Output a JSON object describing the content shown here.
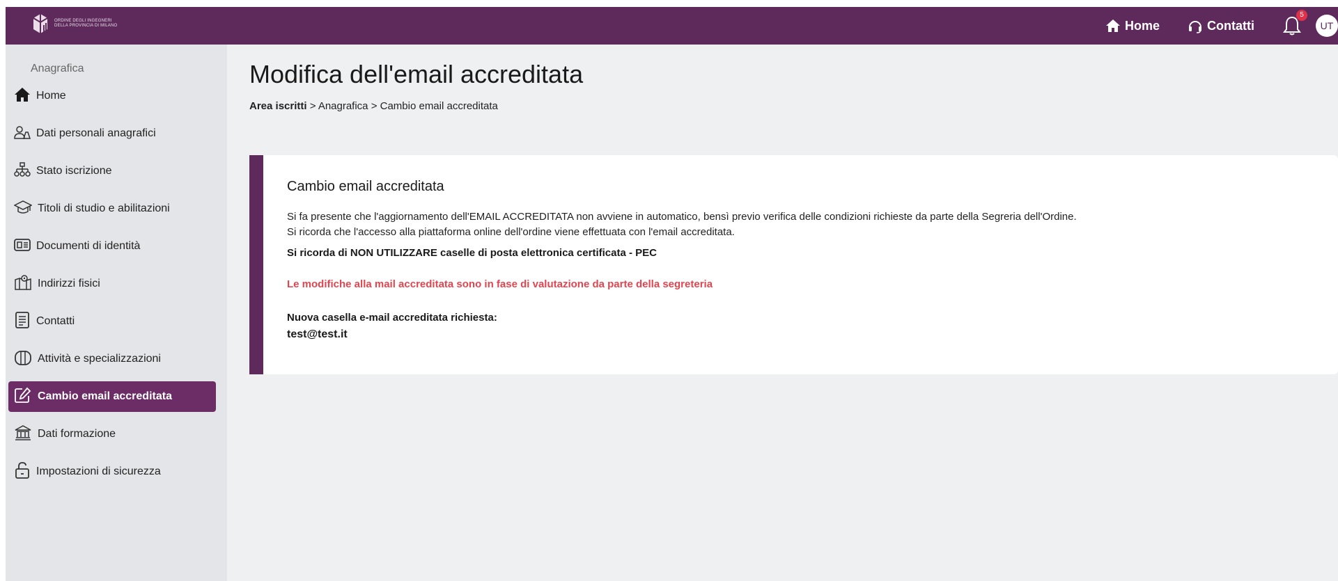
{
  "header": {
    "logo_text_line1": "ORDINE DEGLI INGEGNERI",
    "logo_text_line2": "DELLA PROVINCIA DI MILANO",
    "nav_home": "Home",
    "nav_contatti": "Contatti",
    "notifications_count": "5",
    "avatar_initials": "UT",
    "brand_color": "#5e2a5c"
  },
  "sidebar": {
    "title": "Anagrafica",
    "items": [
      {
        "label": "Home",
        "icon": "home-icon"
      },
      {
        "label": "Dati personali anagrafici",
        "icon": "users-icon"
      },
      {
        "label": "Stato iscrizione",
        "icon": "hierarchy-icon"
      },
      {
        "label": "Titoli di studio e abilitazioni",
        "icon": "graduation-cap-icon"
      },
      {
        "label": "Documenti di identità",
        "icon": "id-card-icon"
      },
      {
        "label": "Indirizzi fisici",
        "icon": "map-pin-icon"
      },
      {
        "label": "Contatti",
        "icon": "document-list-icon"
      },
      {
        "label": "Attività e specializzazioni",
        "icon": "briefcase-icon"
      },
      {
        "label": "Cambio email accreditata",
        "icon": "edit-icon",
        "active": true
      },
      {
        "label": "Dati formazione",
        "icon": "bank-icon"
      },
      {
        "label": "Impostazioni di sicurezza",
        "icon": "unlock-icon"
      }
    ]
  },
  "main": {
    "title": "Modifica dell'email accreditata",
    "breadcrumb": {
      "root": "Area iscritti",
      "rest": " > Anagrafica > Cambio email accreditata"
    },
    "card": {
      "title": "Cambio email accreditata",
      "p1": "Si fa presente che l'aggiornamento dell'EMAIL ACCREDITATA non avviene in automatico, bensì previo verifica delle condizioni richieste da parte della Segreria dell'Ordine.",
      "p2": "Si ricorda che l'accesso alla piattaforma online dell'ordine viene effettuata con l'email accreditata.",
      "pec_note": "Si ricorda di NON UTILIZZARE caselle di posta elettronica certificata - PEC",
      "warning": "Le modifiche alla mail accreditata sono in fase di valutazione da parte della segreteria",
      "warning_color": "#e2454f",
      "new_email_label": "Nuova casella e-mail accreditata richiesta:",
      "new_email_value": "test@test.it"
    }
  }
}
